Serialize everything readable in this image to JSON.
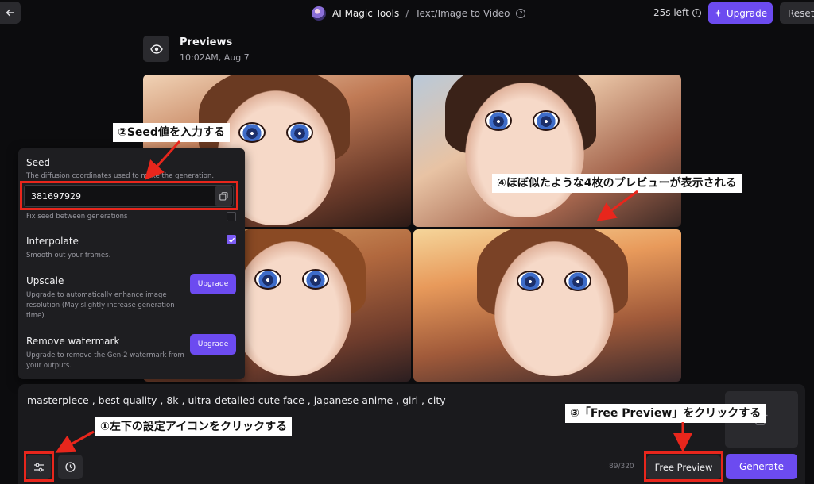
{
  "topbar": {
    "app_name": "AI Magic Tools",
    "separator": "/",
    "page_name": "Text/Image to Video",
    "time_left": "25s left",
    "upgrade_label": "Upgrade",
    "reset_label": "Reset"
  },
  "previews": {
    "title": "Previews",
    "timestamp": "10:02AM, Aug 7"
  },
  "settings": {
    "seed_label": "Seed",
    "seed_desc": "The diffusion coordinates used to make the generation.",
    "seed_value": "381697929",
    "fix_seed_label": "Fix seed between generations",
    "interpolate_label": "Interpolate",
    "interpolate_desc": "Smooth out your frames.",
    "upscale_label": "Upscale",
    "upscale_desc": "Upgrade to automatically enhance image resolution (May slightly increase generation time).",
    "upscale_button": "Upgrade",
    "watermark_label": "Remove watermark",
    "watermark_desc": "Upgrade to remove the Gen-2 watermark from your outputs.",
    "watermark_button": "Upgrade"
  },
  "prompt": {
    "text": "masterpiece , best quality , 8k , ultra-detailed cute face , japanese anime , girl , city",
    "char_count": "89/320",
    "free_preview_label": "Free Preview",
    "generate_label": "Generate"
  },
  "annotations": {
    "a1": "①左下の設定アイコンをクリックする",
    "a2": "②Seed値を入力する",
    "a3": "③「Free Preview」をクリックする",
    "a4": "④ほぼ似たような4枚のプレビューが表示される"
  },
  "colors": {
    "accent": "#6c4bf0",
    "annotation_red": "#e8261c",
    "background": "#0c0c0e"
  }
}
